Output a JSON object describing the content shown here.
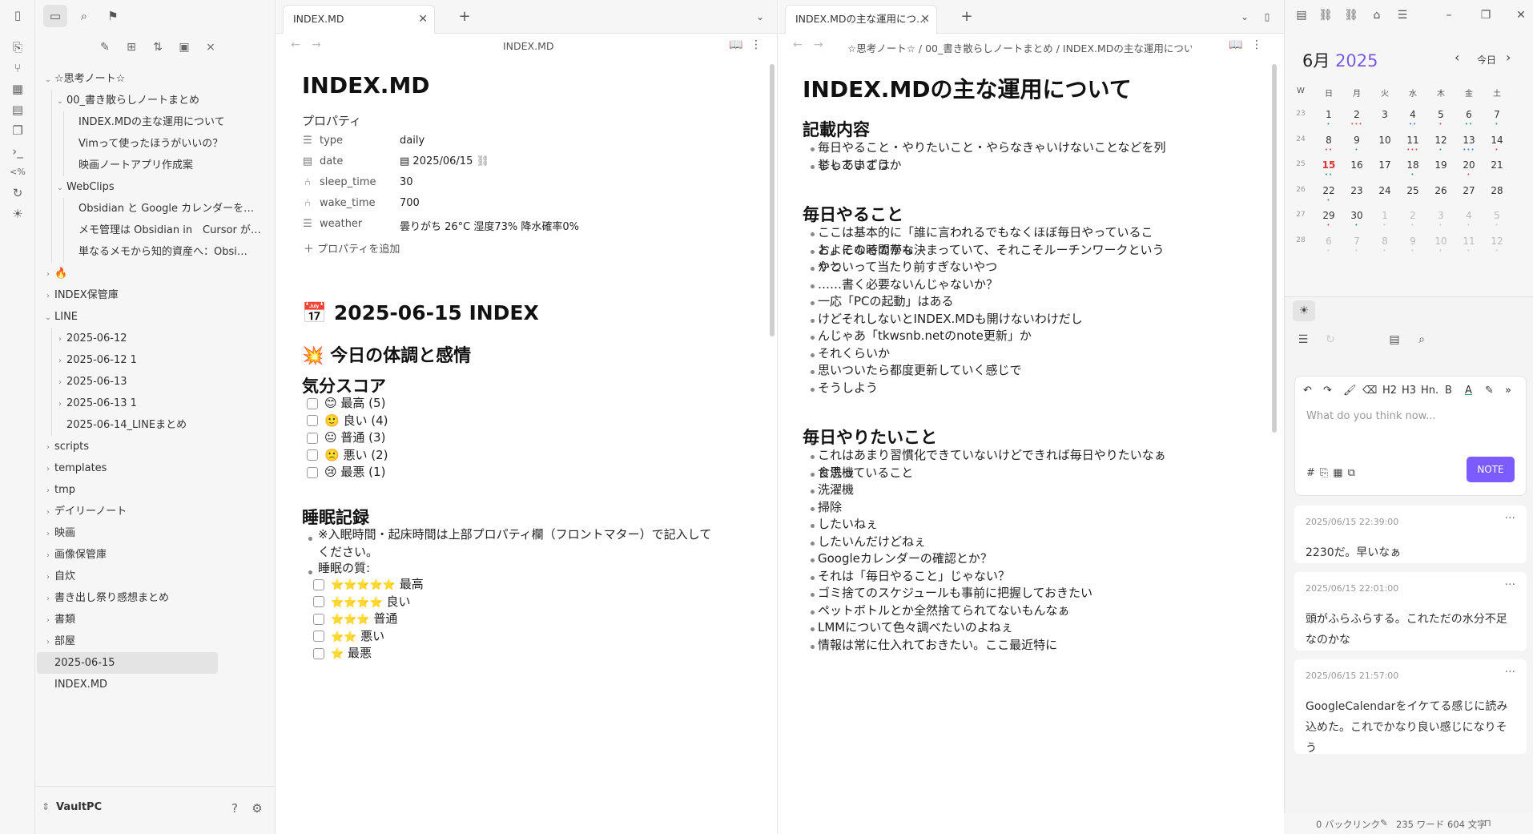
{
  "vault": {
    "name": "VaultPC"
  },
  "tree": [
    {
      "label": "☆思考ノート☆",
      "depth": 0,
      "caret": "down"
    },
    {
      "label": "00_書き散らしノートまとめ",
      "depth": 1,
      "caret": "down"
    },
    {
      "label": "INDEX.MDの主な運用について",
      "depth": 2
    },
    {
      "label": "Vimって使ったほうがいいの？",
      "depth": 2
    },
    {
      "label": "映画ノートアプリ作成案",
      "depth": 2
    },
    {
      "label": "WebClips",
      "depth": 1,
      "caret": "down"
    },
    {
      "label": "Obsidian と Google カレンダーを…",
      "depth": 2
    },
    {
      "label": "メモ管理は Obsidian in　Cursor が…",
      "depth": 2
    },
    {
      "label": "単なるメモから知的資産へ：Obsi…",
      "depth": 2
    },
    {
      "label": "🔥",
      "depth": 0,
      "caret": "right"
    },
    {
      "label": "INDEX保管庫",
      "depth": 0,
      "caret": "right"
    },
    {
      "label": "LINE",
      "depth": 0,
      "caret": "down"
    },
    {
      "label": "2025-06-12",
      "depth": 1,
      "caret": "right"
    },
    {
      "label": "2025-06-12 1",
      "depth": 1,
      "caret": "right"
    },
    {
      "label": "2025-06-13",
      "depth": 1,
      "caret": "right"
    },
    {
      "label": "2025-06-13 1",
      "depth": 1,
      "caret": "right"
    },
    {
      "label": "2025-06-14_LINEまとめ",
      "depth": 1
    },
    {
      "label": "scripts",
      "depth": 0,
      "caret": "right"
    },
    {
      "label": "templates",
      "depth": 0,
      "caret": "right"
    },
    {
      "label": "tmp",
      "depth": 0,
      "caret": "right"
    },
    {
      "label": "デイリーノート",
      "depth": 0,
      "caret": "right"
    },
    {
      "label": "映画",
      "depth": 0,
      "caret": "right"
    },
    {
      "label": "画像保管庫",
      "depth": 0,
      "caret": "right"
    },
    {
      "label": "自炊",
      "depth": 0,
      "caret": "right"
    },
    {
      "label": "書き出し祭り感想まとめ",
      "depth": 0,
      "caret": "right"
    },
    {
      "label": "書類",
      "depth": 0,
      "caret": "right"
    },
    {
      "label": "部屋",
      "depth": 0,
      "caret": "right"
    },
    {
      "label": "2025-06-15",
      "depth": 0,
      "selected": true
    },
    {
      "label": "INDEX.MD",
      "depth": 0
    }
  ],
  "left_pane": {
    "tab": "INDEX.MD",
    "nav_title": "INDEX.MD",
    "title": "INDEX.MD",
    "properties_label": "プロパティ",
    "properties": [
      {
        "icon": "list-icon",
        "key": "type",
        "value": "daily"
      },
      {
        "icon": "calendar-icon",
        "key": "date",
        "value": "2025/06/15"
      },
      {
        "icon": "number-icon",
        "key": "sleep_time",
        "value": "30"
      },
      {
        "icon": "number-icon",
        "key": "wake_time",
        "value": "700"
      },
      {
        "icon": "list-icon",
        "key": "weather",
        "value": "曇りがち 26°C 湿度73% 降水確率0%"
      }
    ],
    "add_property": "プロパティを追加",
    "h_index": "2025-06-15 INDEX",
    "h_condition": "今日の体調と感情",
    "h_mood": "気分スコア",
    "mood": [
      "😊 最高 (5)",
      "🙂 良い (4)",
      "😐 普通 (3)",
      "🙁 悪い (2)",
      "😢 最悪 (1)"
    ],
    "h_sleep": "睡眠記録",
    "sleep_bullets": [
      "※入眠時間・起床時間は上部プロパティ欄（フロントマター）で記入して",
      "ください。",
      "睡眠の質:"
    ],
    "sleep_quality": [
      {
        "stars": "⭐⭐⭐⭐⭐",
        "label": "最高"
      },
      {
        "stars": "⭐⭐⭐⭐",
        "label": "良い"
      },
      {
        "stars": "⭐⭐⭐",
        "label": "普通"
      },
      {
        "stars": "⭐⭐",
        "label": "悪い"
      },
      {
        "stars": "⭐",
        "label": "最悪"
      }
    ]
  },
  "right_pane": {
    "tab": "INDEX.MDの主な運用につ…",
    "breadcrumb": "☆思考ノート☆ / 00_書き散らしノートまとめ / INDEX.MDの主な運用について",
    "title": "INDEX.MDの主な運用について",
    "sections": [
      {
        "heading": "記載内容",
        "lines": [
          "毎日やること・やりたいこと・やらなきゃいけないことなどを列挙していこうか",
          "じゃあまずは"
        ]
      },
      {
        "heading": "毎日やること",
        "lines": [
          "ここは基本的に「誰に言われるでもなくほぼ毎日やっていること」になるのかな",
          "およその時間帯も決まっていて、それこそルーチンワークというやつ",
          "かといって当たり前すぎないやつ",
          "……書く必要ないんじゃないか？",
          "一応「PCの起動」はある",
          "けどそれしないとINDEX.MDも開けないわけだし",
          "んじゃあ「tkwsnb.netのnote更新」か",
          "それくらいか",
          "思いついたら都度更新していく感じで",
          "そうしよう"
        ]
      },
      {
        "heading": "毎日やりたいこと",
        "lines": [
          "これはあまり習慣化できていないけどできれば毎日やりたいなぁと思っていること",
          "食洗機",
          "洗濯機",
          "掃除",
          "したいねぇ",
          "したいんだけどねぇ",
          "Googleカレンダーの確認とか？",
          "それは「毎日やること」じゃない？",
          "ゴミ捨てのスケジュールも事前に把握しておきたい",
          "ペットボトルとか全然捨てられてないもんなぁ",
          "LMMについて色々調べたいのよねぇ",
          "情報は常に仕入れておきたい。ここ最近特に"
        ]
      }
    ]
  },
  "calendar": {
    "month": "6月",
    "year": "2025",
    "today_label": "今日",
    "weekdays": [
      "W",
      "日",
      "月",
      "火",
      "水",
      "木",
      "金",
      "土"
    ],
    "weeks": [
      {
        "wk": "23",
        "days": [
          "1",
          "2",
          "3",
          "4",
          "5",
          "6",
          "7"
        ]
      },
      {
        "wk": "24",
        "days": [
          "8",
          "9",
          "10",
          "11",
          "12",
          "13",
          "14"
        ]
      },
      {
        "wk": "25",
        "days": [
          "15",
          "16",
          "17",
          "18",
          "19",
          "20",
          "21"
        ]
      },
      {
        "wk": "26",
        "days": [
          "22",
          "23",
          "24",
          "25",
          "26",
          "27",
          "28"
        ]
      },
      {
        "wk": "27",
        "days": [
          "29",
          "30",
          "1",
          "2",
          "3",
          "4",
          "5"
        ]
      },
      {
        "wk": "28",
        "days": [
          "6",
          "7",
          "8",
          "9",
          "10",
          "11",
          "12"
        ]
      }
    ],
    "today_day": "15"
  },
  "memos": {
    "placeholder": "What do you think now...",
    "note_button": "NOTE",
    "toolbar": [
      "↶",
      "↷",
      "🖌",
      "⌫",
      "H2",
      "H3",
      "Hn.",
      "B",
      "A",
      "✎",
      "»"
    ],
    "cards": [
      {
        "time": "2025/06/15 22:39:00",
        "text": "2230だ。早いなぁ"
      },
      {
        "time": "2025/06/15 22:01:00",
        "text": "頭がふらふらする。これただの水分不足なのかな"
      },
      {
        "time": "2025/06/15 21:57:00",
        "text": "GoogleCalendarをイケてる感じに読み込めた。これでかなり良い感じになりそう"
      }
    ]
  },
  "status_bar": {
    "backlinks": "0 バックリンク",
    "words": "235 ワード",
    "chars": "604 文字"
  },
  "colors": {
    "accent": "#7c5cff",
    "today": "#d33333"
  }
}
